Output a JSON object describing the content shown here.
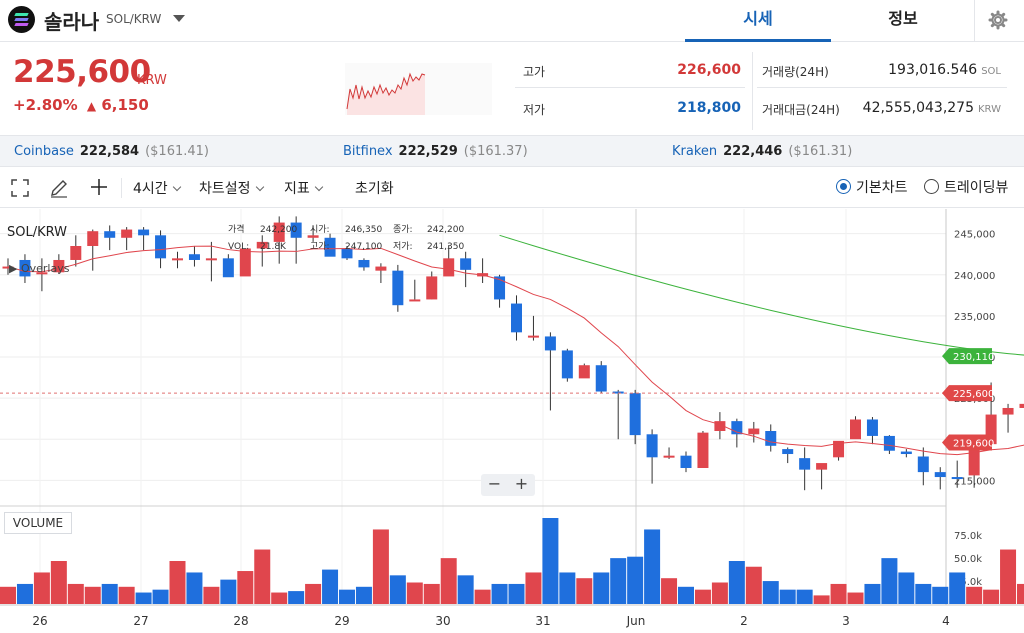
{
  "header": {
    "coin_name": "솔라나",
    "pair": "SOL/KRW",
    "tabs": [
      {
        "label": "시세",
        "active": true
      },
      {
        "label": "정보",
        "active": false
      }
    ],
    "settings_icon": "gear-icon"
  },
  "price": {
    "current": "225,600",
    "currency": "KRW",
    "change_pct": "+2.80%",
    "change_amount": "6,150",
    "change_arrow": "▲"
  },
  "stats": {
    "high_label": "고가",
    "high": "226,600",
    "low_label": "저가",
    "low": "218,800",
    "volume_label": "거래량(24H)",
    "volume": "193,016.546",
    "volume_unit": "SOL",
    "amount_label": "거래대금(24H)",
    "amount": "42,555,043,275",
    "amount_unit": "KRW"
  },
  "exchanges": [
    {
      "name": "Coinbase",
      "price": "222,584",
      "usd": "($161.41)"
    },
    {
      "name": "Bitfinex",
      "price": "222,529",
      "usd": "($161.37)"
    },
    {
      "name": "Kraken",
      "price": "222,446",
      "usd": "($161.31)"
    }
  ],
  "toolbar": {
    "interval": "4시간",
    "chart_settings": "차트설정",
    "indicators": "지표",
    "reset": "초기화",
    "basic_chart": "기본차트",
    "trading_view": "트레이딩뷰"
  },
  "chart": {
    "pair_label": "SOL/KRW",
    "overlays_label": "Overlays",
    "volume_label": "VOLUME",
    "ohlc": {
      "row1": [
        "가격",
        "242,200",
        "시가:",
        "246,350",
        "종가:",
        "242,200"
      ],
      "row2": [
        "VOL:",
        "21.8K",
        "고가:",
        "247,100",
        "저가:",
        "241,350"
      ]
    },
    "zoom_minus": "−",
    "zoom_plus": "+",
    "y_ticks": [
      "245,000",
      "240,000",
      "235,000",
      "230,000",
      "225,000",
      "220,000",
      "215,000"
    ],
    "vol_ticks": [
      "75.0k",
      "50.0k",
      "25.0k"
    ],
    "x_labels": [
      "26",
      "27",
      "28",
      "29",
      "30",
      "31",
      "Jun",
      "2",
      "3",
      "4"
    ],
    "price_tags": [
      {
        "value": "230,110",
        "color": "#3cb33c"
      },
      {
        "value": "225,600",
        "color": "#e04848"
      },
      {
        "value": "219,600",
        "color": "#e04848"
      }
    ],
    "colors": {
      "up": "#e0464d",
      "down": "#1f6fdd",
      "ma_short": "#e0464d",
      "ma_long": "#3cb33c"
    }
  },
  "chart_data": {
    "type": "candlestick",
    "x_labels": [
      "26",
      "27",
      "28",
      "29",
      "30",
      "31",
      "Jun",
      "2",
      "3",
      "4"
    ],
    "ylim": [
      212000,
      248000
    ],
    "candles": [
      [
        241000,
        242000,
        240000,
        241000
      ],
      [
        241800,
        242500,
        239000,
        239800
      ],
      [
        240200,
        242000,
        238000,
        240300
      ],
      [
        240300,
        242500,
        240200,
        241800
      ],
      [
        241800,
        244800,
        241000,
        243500
      ],
      [
        243500,
        245500,
        240500,
        245300
      ],
      [
        245300,
        246000,
        243000,
        244500
      ],
      [
        244500,
        245800,
        243000,
        245500
      ],
      [
        245500,
        245800,
        243000,
        244800
      ],
      [
        244800,
        245400,
        240800,
        242000
      ],
      [
        242000,
        242800,
        240800,
        242000
      ],
      [
        242500,
        243500,
        241000,
        241800
      ],
      [
        241800,
        244000,
        239200,
        242000
      ],
      [
        242000,
        242500,
        240500,
        239700
      ],
      [
        239800,
        243200,
        240600,
        243200
      ],
      [
        243200,
        244800,
        241000,
        244000
      ],
      [
        244000,
        247100,
        241350,
        246350
      ],
      [
        246350,
        247100,
        241350,
        244500
      ],
      [
        244500,
        246000,
        244000,
        244800
      ],
      [
        244500,
        245000,
        242500,
        242200
      ],
      [
        243200,
        243500,
        241800,
        242000
      ],
      [
        241800,
        242000,
        240500,
        240900
      ],
      [
        240500,
        241400,
        239000,
        241000
      ],
      [
        240500,
        241200,
        235500,
        236300
      ],
      [
        237000,
        239400,
        237000,
        237000
      ],
      [
        237000,
        240400,
        237000,
        239800
      ],
      [
        239800,
        243600,
        240000,
        242000
      ],
      [
        242000,
        242800,
        238500,
        240600
      ],
      [
        239800,
        242000,
        239000,
        240200
      ],
      [
        239800,
        240000,
        236000,
        237000
      ],
      [
        236500,
        237500,
        232000,
        233000
      ],
      [
        232500,
        235000,
        232000,
        232600
      ],
      [
        232500,
        233000,
        223500,
        230800
      ],
      [
        230800,
        231000,
        227000,
        227400
      ],
      [
        227400,
        229200,
        228000,
        229000
      ],
      [
        229000,
        229500,
        225600,
        225800
      ],
      [
        225800,
        226000,
        220000,
        225600
      ],
      [
        225600,
        226000,
        219400,
        220500
      ],
      [
        220600,
        221200,
        214600,
        217800
      ],
      [
        217800,
        219000,
        217600,
        218000
      ],
      [
        218000,
        218500,
        216000,
        216500
      ],
      [
        216500,
        221000,
        216500,
        220800
      ],
      [
        221000,
        223300,
        220000,
        222200
      ],
      [
        222200,
        222500,
        219000,
        220600
      ],
      [
        220600,
        222100,
        219600,
        221300
      ],
      [
        221000,
        221800,
        218500,
        219200
      ],
      [
        218800,
        219000,
        217100,
        218200
      ],
      [
        217700,
        219000,
        213800,
        216300
      ],
      [
        216300,
        217000,
        213900,
        217100
      ],
      [
        217800,
        219600,
        217400,
        219800
      ],
      [
        220000,
        222800,
        220200,
        222400
      ],
      [
        222400,
        222700,
        219400,
        220400
      ],
      [
        220400,
        220500,
        218200,
        218600
      ],
      [
        218500,
        218800,
        217800,
        218200
      ],
      [
        217900,
        219000,
        214400,
        216000
      ],
      [
        216000,
        216600,
        213900,
        215400
      ],
      [
        215400,
        217400,
        214100,
        215200
      ],
      [
        215600,
        219600,
        214100,
        219300
      ],
      [
        219400,
        226900,
        219300,
        223000
      ],
      [
        223000,
        224300,
        220800,
        223800
      ],
      [
        223800,
        225600,
        221700,
        224300
      ],
      [
        224200,
        225800,
        223000,
        225600
      ]
    ],
    "volumes": [
      12,
      14,
      22,
      30,
      14,
      12,
      14,
      12,
      8,
      10,
      30,
      22,
      12,
      17,
      23,
      38,
      8,
      9,
      14,
      24,
      10,
      12,
      52,
      20,
      15,
      14,
      32,
      20,
      10,
      14,
      14,
      22,
      60,
      22,
      18,
      22,
      32,
      33,
      52,
      18,
      12,
      10,
      15,
      30,
      26,
      16,
      10,
      10,
      6,
      14,
      8,
      14,
      32,
      22,
      14,
      12,
      22,
      12,
      10,
      38,
      14,
      3
    ],
    "ma_short_end": 219600,
    "ma_long_end": 230110,
    "current": 225600
  }
}
